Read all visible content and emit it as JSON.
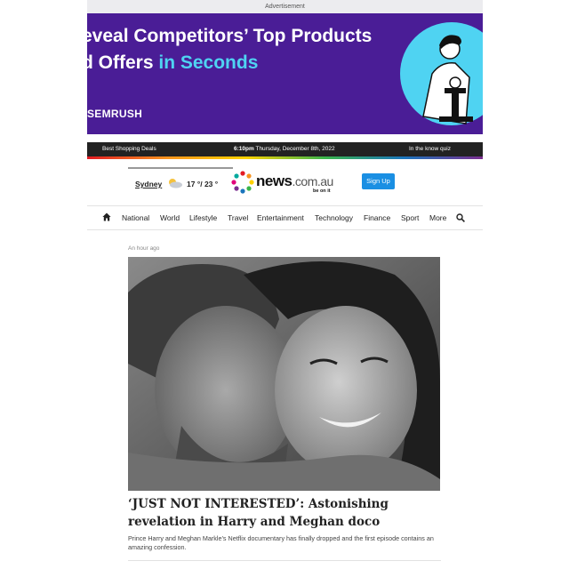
{
  "ad": {
    "label": "Advertisement",
    "line1": "eveal Competitors’ Top Products",
    "line2_white": "d Offers ",
    "line2_blue": "in Seconds",
    "brand": "SEMRUSH"
  },
  "topbar": {
    "left": "Best Shopping Deals",
    "time": "6:10pm",
    "date": "Thursday, December 8th, 2022",
    "right": "In the know quiz"
  },
  "header": {
    "city": "Sydney",
    "weather_icon": "partly-cloudy-icon",
    "temperature": "17 °/ 23 °",
    "logo_text": "news",
    "logo_tld": ".com.au",
    "logo_tagline": "be on it",
    "signup_label": "Sign Up"
  },
  "nav": {
    "home_icon": "home-icon",
    "items": [
      "National",
      "World",
      "Lifestyle",
      "Travel",
      "Entertainment",
      "Technology",
      "Finance",
      "Sport",
      "More"
    ],
    "search_icon": "search-icon"
  },
  "article": {
    "time": "An hour ago",
    "headline": "‘JUST NOT INTERESTED’: Astonishing revelation in Harry and Meghan doco",
    "summary": "Prince Harry and Meghan Markle’s Netflix documentary has finally dropped and the first episode contains an amazing confession."
  },
  "colors": {
    "ad_bg": "#4a1d96",
    "ad_highlight": "#4fd3f2",
    "topbar_bg": "#222222",
    "signup_bg": "#1a8fe3"
  }
}
